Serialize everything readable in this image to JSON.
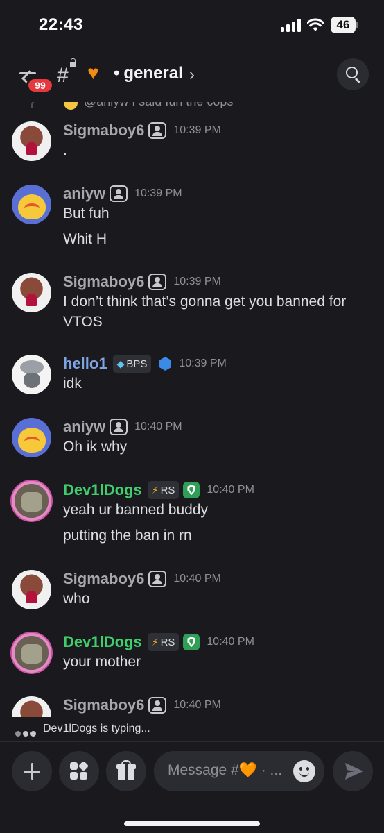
{
  "status_bar": {
    "time": "22:43",
    "battery": "46"
  },
  "header": {
    "mention_count": "99",
    "channel_dot": "•",
    "channel_name": "general",
    "chevron": "›"
  },
  "reply_preview": {
    "text": "@aniyw I said fun the cops"
  },
  "messages": [
    {
      "user": "Sigmaboy6",
      "time": "10:39 PM",
      "lines": [
        "."
      ]
    },
    {
      "user": "aniyw",
      "time": "10:39 PM",
      "lines": [
        "But fuh",
        "Whit H"
      ]
    },
    {
      "user": "Sigmaboy6",
      "time": "10:39 PM",
      "lines": [
        "I don’t think that’s gonna get you banned for VTOS"
      ]
    },
    {
      "user": "hello1",
      "tag": "BPS",
      "time": "10:39 PM",
      "lines": [
        "idk"
      ]
    },
    {
      "user": "aniyw",
      "time": "10:40 PM",
      "lines": [
        "Oh ik why"
      ]
    },
    {
      "user": "Dev1lDogs",
      "tag": "RS",
      "time": "10:40 PM",
      "lines": [
        "yeah ur banned buddy",
        "putting the ban in rn"
      ]
    },
    {
      "user": "Sigmaboy6",
      "time": "10:40 PM",
      "lines": [
        "who"
      ]
    },
    {
      "user": "Dev1lDogs",
      "tag": "RS",
      "time": "10:40 PM",
      "lines": [
        "your mother"
      ]
    },
    {
      "user": "Sigmaboy6",
      "time": "10:40 PM",
      "lines": []
    }
  ],
  "typing_indicator": "Dev1lDogs is typing...",
  "composer": {
    "placeholder": "Message #🧡 · ..."
  },
  "icons": {
    "back": "arrow-left-icon",
    "channel": "locked-hash-icon",
    "search": "search-icon",
    "plus": "plus-icon",
    "apps": "apps-icon",
    "gift": "gift-icon",
    "emoji": "emoji-icon",
    "send": "send-icon"
  },
  "colors": {
    "background": "#1a1a1e",
    "mention_badge": "#e5393f",
    "username_default": "#a7a8ad",
    "username_green": "#3ece6c",
    "username_blue": "#7fa4e4"
  }
}
